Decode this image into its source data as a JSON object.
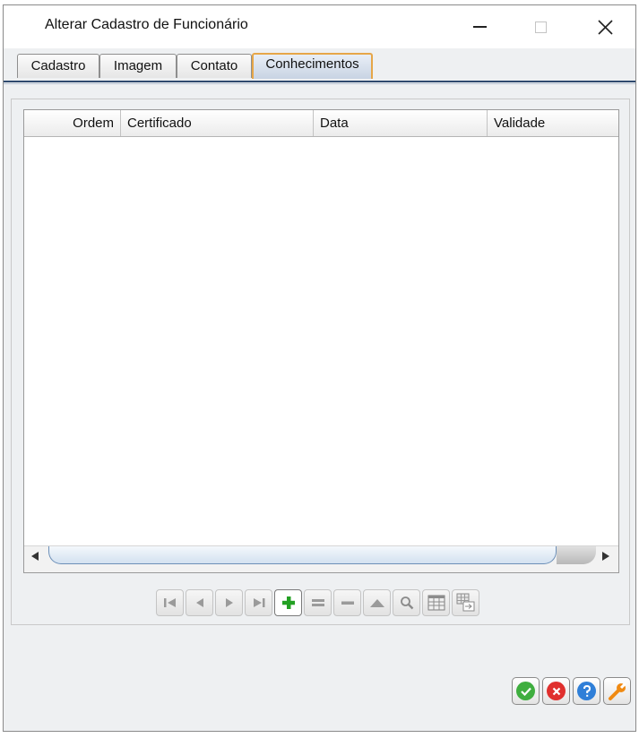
{
  "window": {
    "title": "Alterar Cadastro de Funcionário",
    "controls": {
      "minimize": "minimize-icon",
      "maximize": "maximize-icon",
      "close": "close-icon"
    }
  },
  "tabs": [
    {
      "label": "Cadastro",
      "active": false
    },
    {
      "label": "Imagem",
      "active": false
    },
    {
      "label": "Contato",
      "active": false
    },
    {
      "label": "Conhecimentos",
      "active": true
    }
  ],
  "grid": {
    "columns": [
      "Ordem",
      "Certificado",
      "Data",
      "Validade"
    ],
    "rows": []
  },
  "navigator": [
    {
      "icon": "first-record-icon",
      "enabled": false
    },
    {
      "icon": "prior-record-icon",
      "enabled": false
    },
    {
      "icon": "next-record-icon",
      "enabled": false
    },
    {
      "icon": "last-record-icon",
      "enabled": false
    },
    {
      "icon": "insert-record-icon",
      "enabled": true
    },
    {
      "icon": "edit-record-icon",
      "enabled": false
    },
    {
      "icon": "delete-record-icon",
      "enabled": false
    },
    {
      "icon": "post-record-icon",
      "enabled": false
    },
    {
      "icon": "search-record-icon",
      "enabled": false
    },
    {
      "icon": "grid-view-icon",
      "enabled": false
    },
    {
      "icon": "export-grid-icon",
      "enabled": false
    }
  ],
  "actions": [
    {
      "icon": "confirm-icon",
      "color": "#3fae3f"
    },
    {
      "icon": "cancel-icon",
      "color": "#e0302e"
    },
    {
      "icon": "help-icon",
      "color": "#2f7fd8"
    },
    {
      "icon": "wrench-icon",
      "color": "#f08a12"
    }
  ]
}
